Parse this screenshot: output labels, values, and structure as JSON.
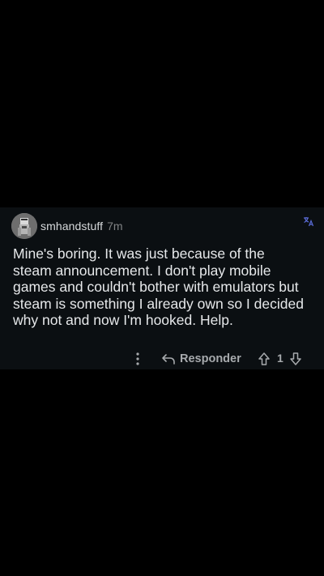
{
  "comment": {
    "username": "smhandstuff",
    "timestamp": "7m",
    "body": "Mine's boring. It was just because of the\nsteam announcement. I don't play mobile\ngames and couldn't bother with emulators but\nsteam is something I already own so I decided\nwhy not and now I'm hooked. Help.",
    "icons": {
      "avatar": "user-avatar",
      "translate": "translate-icon",
      "more": "more-vertical-icon",
      "reply": "reply-arrow-icon",
      "upvote": "arrow-up-icon",
      "downvote": "arrow-down-icon"
    }
  },
  "actions": {
    "reply_label": "Responder",
    "vote_count": "1"
  },
  "colors": {
    "background": "#000000",
    "card_background": "#0b0f12",
    "text_primary": "#e6e8ea",
    "text_secondary": "#818384",
    "action_text": "#a7aaad"
  }
}
